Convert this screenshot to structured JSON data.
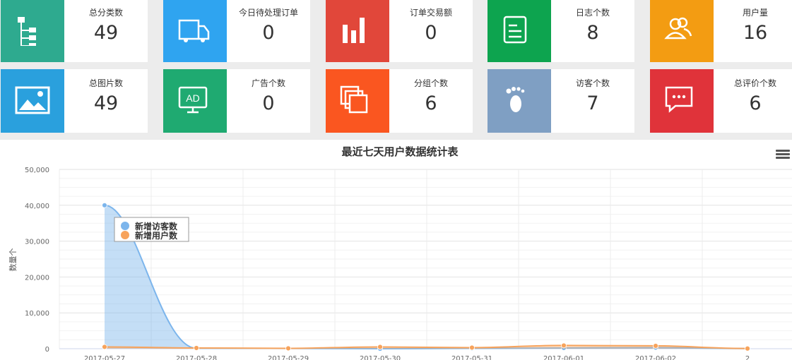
{
  "stats": [
    {
      "label": "总分类数",
      "value": "49",
      "color": "#2eaa8f",
      "icon": "tree-structure-icon"
    },
    {
      "label": "今日待处理订单",
      "value": "0",
      "color": "#2fa4f0",
      "icon": "delivery-truck-icon"
    },
    {
      "label": "订单交易额",
      "value": "0",
      "color": "#e1473a",
      "icon": "bar-chart-icon"
    },
    {
      "label": "日志个数",
      "value": "8",
      "color": "#0da44f",
      "icon": "document-list-icon"
    },
    {
      "label": "用户量",
      "value": "16",
      "color": "#f39c12",
      "icon": "users-icon"
    },
    {
      "label": "总图片数",
      "value": "49",
      "color": "#2aa0dd",
      "icon": "image-icon"
    },
    {
      "label": "广告个数",
      "value": "0",
      "color": "#1faa71",
      "icon": "ad-monitor-icon"
    },
    {
      "label": "分组个数",
      "value": "6",
      "color": "#fa5620",
      "icon": "stacked-squares-icon"
    },
    {
      "label": "访客个数",
      "value": "7",
      "color": "#7f9fc3",
      "icon": "footprint-icon"
    },
    {
      "label": "总评价个数",
      "value": "6",
      "color": "#e0333a",
      "icon": "chat-bubble-icon"
    }
  ],
  "chart_data": {
    "type": "area",
    "title": "最近七天用户数据统计表",
    "ylabel": "数量个",
    "xlabel": "",
    "categories": [
      "2017-05-27",
      "2017-05-28",
      "2017-05-29",
      "2017-05-30",
      "2017-05-31",
      "2017-06-01",
      "2017-06-02",
      "2"
    ],
    "series": [
      {
        "name": "新增访客数",
        "color": "#7cb5ec",
        "values": [
          40000,
          120,
          80,
          0,
          100,
          200,
          300,
          50
        ]
      },
      {
        "name": "新增用户数",
        "color": "#f7a35c",
        "values": [
          500,
          200,
          100,
          500,
          300,
          900,
          800,
          50
        ]
      }
    ],
    "yticks": [
      "0",
      "10,000",
      "20,000",
      "30,000",
      "40,000",
      "50,000"
    ],
    "ylim": [
      0,
      50000
    ],
    "legend": "top-left inside plot",
    "grid": true
  },
  "toolbar": {
    "menu": "menu"
  }
}
